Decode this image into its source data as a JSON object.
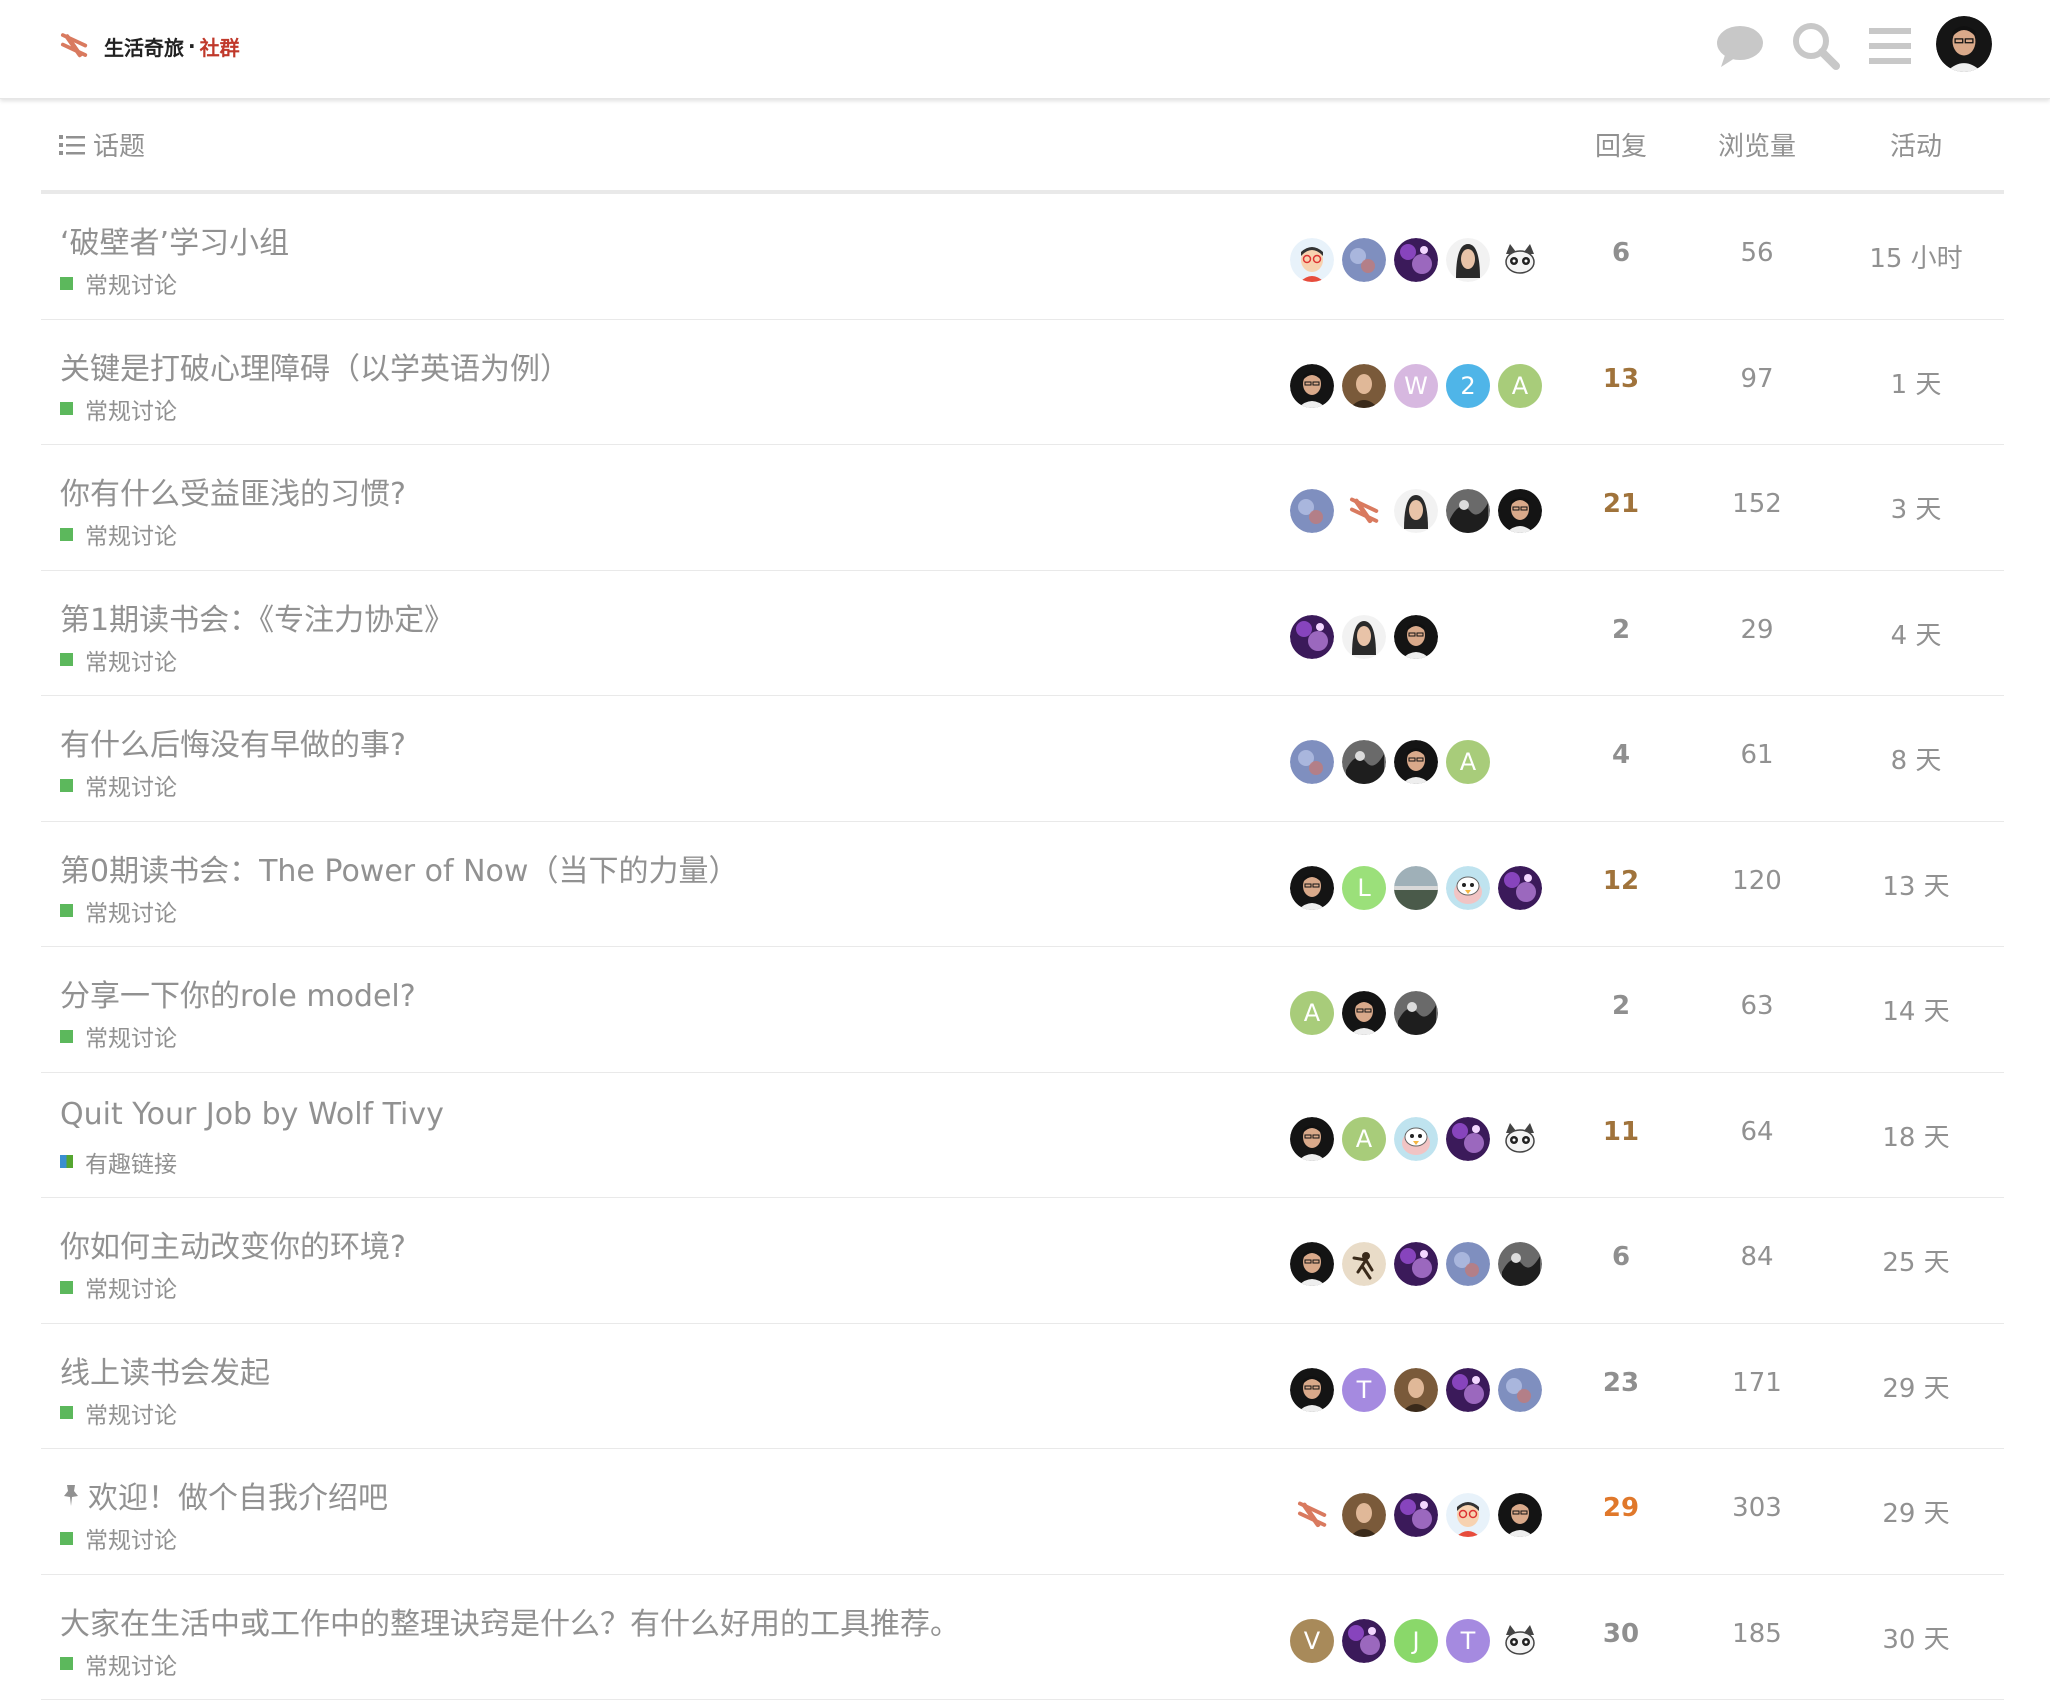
{
  "site": {
    "name": "生活奇旅",
    "separator": "·",
    "suffix": "社群"
  },
  "header_icons": [
    "chat-icon",
    "search-icon",
    "hamburger-menu-icon",
    "user-avatar"
  ],
  "table": {
    "topic_header": "话题",
    "replies_header": "回复",
    "views_header": "浏览量",
    "activity_header": "活动"
  },
  "colors": {
    "category_general": "#5cb85c",
    "category_links_a": "#3a8fd1",
    "category_links_b": "#55a630",
    "replies_mid": "#a0733b",
    "replies_high": "#e0782b",
    "logo_accent": "#c0392b"
  },
  "topics": [
    {
      "title": "‘破壁者’学习小组",
      "category": "常规讨论",
      "replies": "6",
      "views": "56",
      "activity": "15 小时",
      "heat": "low",
      "posters": [
        {
          "kind": "cartoon"
        },
        {
          "kind": "blue"
        },
        {
          "kind": "purple"
        },
        {
          "kind": "woman"
        },
        {
          "kind": "raccoon"
        }
      ]
    },
    {
      "title": "关键是打破心理障碍（以学英语为例）",
      "category": "常规讨论",
      "replies": "13",
      "views": "97",
      "activity": "1 天",
      "heat": "mid",
      "posters": [
        {
          "kind": "man"
        },
        {
          "kind": "photo"
        },
        {
          "kind": "letter",
          "letter": "W",
          "color": "#d7b8e0"
        },
        {
          "kind": "letter",
          "letter": "2",
          "color": "#4fb5e8"
        },
        {
          "kind": "letter",
          "letter": "A",
          "color": "#a8cc7a"
        }
      ]
    },
    {
      "title": "你有什么受益匪浅的习惯?",
      "category": "常规讨论",
      "replies": "21",
      "views": "152",
      "activity": "3 天",
      "heat": "mid",
      "posters": [
        {
          "kind": "blue"
        },
        {
          "kind": "logo"
        },
        {
          "kind": "woman"
        },
        {
          "kind": "bw"
        },
        {
          "kind": "man"
        }
      ]
    },
    {
      "title": "第1期读书会：《专注力协定》",
      "category": "常规讨论",
      "replies": "2",
      "views": "29",
      "activity": "4 天",
      "heat": "low",
      "posters": [
        {
          "kind": "purple"
        },
        {
          "kind": "woman"
        },
        {
          "kind": "man"
        }
      ]
    },
    {
      "title": "有什么后悔没有早做的事?",
      "category": "常规讨论",
      "replies": "4",
      "views": "61",
      "activity": "8 天",
      "heat": "low",
      "posters": [
        {
          "kind": "blue"
        },
        {
          "kind": "bw"
        },
        {
          "kind": "man"
        },
        {
          "kind": "letter",
          "letter": "A",
          "color": "#a8cc7a"
        }
      ]
    },
    {
      "title": "第0期读书会：The Power of Now（当下的力量）",
      "category": "常规讨论",
      "replies": "12",
      "views": "120",
      "activity": "13 天",
      "heat": "mid",
      "posters": [
        {
          "kind": "man"
        },
        {
          "kind": "letter",
          "letter": "L",
          "color": "#9be07a"
        },
        {
          "kind": "landscape"
        },
        {
          "kind": "bird"
        },
        {
          "kind": "purple"
        }
      ]
    },
    {
      "title": "分享一下你的role model?",
      "category": "常规讨论",
      "replies": "2",
      "views": "63",
      "activity": "14 天",
      "heat": "low",
      "posters": [
        {
          "kind": "letter",
          "letter": "A",
          "color": "#a8cc7a"
        },
        {
          "kind": "man"
        },
        {
          "kind": "bw"
        }
      ]
    },
    {
      "title": "Quit Your Job by Wolf Tivy",
      "category": "有趣链接",
      "category_type": "links",
      "replies": "11",
      "views": "64",
      "activity": "18 天",
      "heat": "mid",
      "posters": [
        {
          "kind": "man"
        },
        {
          "kind": "letter",
          "letter": "A",
          "color": "#a8cc7a"
        },
        {
          "kind": "bird"
        },
        {
          "kind": "purple"
        },
        {
          "kind": "raccoon"
        }
      ]
    },
    {
      "title": "你如何主动改变你的环境?",
      "category": "常规讨论",
      "replies": "6",
      "views": "84",
      "activity": "25 天",
      "heat": "low",
      "posters": [
        {
          "kind": "man"
        },
        {
          "kind": "dancer"
        },
        {
          "kind": "purple"
        },
        {
          "kind": "blue"
        },
        {
          "kind": "bw"
        }
      ]
    },
    {
      "title": "线上读书会发起",
      "category": "常规讨论",
      "replies": "23",
      "views": "171",
      "activity": "29 天",
      "heat": "low",
      "posters": [
        {
          "kind": "man"
        },
        {
          "kind": "letter",
          "letter": "T",
          "color": "#a58ae0"
        },
        {
          "kind": "photo"
        },
        {
          "kind": "purple"
        },
        {
          "kind": "blue"
        }
      ]
    },
    {
      "title": "欢迎！做个自我介绍吧",
      "pinned": true,
      "category": "常规讨论",
      "replies": "29",
      "views": "303",
      "activity": "29 天",
      "heat": "high",
      "posters": [
        {
          "kind": "logo"
        },
        {
          "kind": "photo"
        },
        {
          "kind": "purple"
        },
        {
          "kind": "cartoon"
        },
        {
          "kind": "man"
        }
      ]
    },
    {
      "title": "大家在生活中或工作中的整理诀窍是什么？有什么好用的工具推荐。",
      "category": "常规讨论",
      "replies": "30",
      "views": "185",
      "activity": "30 天",
      "heat": "low",
      "posters": [
        {
          "kind": "letter",
          "letter": "V",
          "color": "#a88a5a"
        },
        {
          "kind": "purple"
        },
        {
          "kind": "letter",
          "letter": "J",
          "color": "#8ad86a"
        },
        {
          "kind": "letter",
          "letter": "T",
          "color": "#a58ae0"
        },
        {
          "kind": "raccoon"
        }
      ]
    }
  ]
}
